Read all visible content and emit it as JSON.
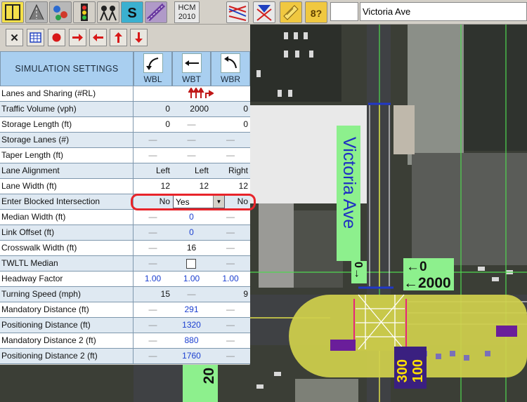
{
  "toolbar": {
    "hcm_line1": "HCM",
    "hcm_line2": "2010",
    "search_value": "",
    "street_name": "Victoria Ave",
    "buttons": [
      "node-settings-icon",
      "lane-settings-icon",
      "volume-settings-icon",
      "timing-settings-icon",
      "phasing-settings-icon",
      "simulation-settings-icon",
      "detector-settings-icon",
      "report-icon",
      "animation-icon",
      "map-info-icon",
      "help-icon"
    ]
  },
  "panel": {
    "tools": [
      "close-icon",
      "table-icon",
      "record-icon",
      "step-right-icon",
      "step-left-icon",
      "up-arrow-icon",
      "down-arrow-icon"
    ],
    "close_glyph": "✕",
    "header": "SIMULATION SETTINGS",
    "movements": [
      "WBL",
      "WBT",
      "WBR"
    ],
    "rows": [
      {
        "label": "Lanes and Sharing (#RL)",
        "values": [
          "",
          "",
          ""
        ]
      },
      {
        "label": "Traffic Volume (vph)",
        "values": [
          "0",
          "2000",
          "0"
        ]
      },
      {
        "label": "Storage Length (ft)",
        "values": [
          "0",
          "—",
          "0"
        ]
      },
      {
        "label": "Storage Lanes (#)",
        "values": [
          "—",
          "—",
          "—"
        ]
      },
      {
        "label": "Taper Length (ft)",
        "values": [
          "—",
          "—",
          "—"
        ]
      },
      {
        "label": "Lane Alignment",
        "values": [
          "Left",
          "Left",
          "Right"
        ]
      },
      {
        "label": "Lane Width (ft)",
        "values": [
          "12",
          "12",
          "12"
        ]
      },
      {
        "label": "Enter Blocked Intersection",
        "values": [
          "No",
          "Yes",
          "No"
        ]
      },
      {
        "label": "Median Width (ft)",
        "values": [
          "—",
          "0",
          "—"
        ]
      },
      {
        "label": "Link Offset (ft)",
        "values": [
          "—",
          "0",
          "—"
        ]
      },
      {
        "label": "Crosswalk Width (ft)",
        "values": [
          "—",
          "16",
          "—"
        ]
      },
      {
        "label": "TWLTL Median",
        "values": [
          "—",
          "",
          "—"
        ]
      },
      {
        "label": "Headway Factor",
        "values": [
          "1.00",
          "1.00",
          "1.00"
        ]
      },
      {
        "label": "Turning Speed (mph)",
        "values": [
          "15",
          "—",
          "9"
        ]
      },
      {
        "label": "Mandatory Distance (ft)",
        "values": [
          "—",
          "291",
          "—"
        ]
      },
      {
        "label": "Positioning Distance (ft)",
        "values": [
          "—",
          "1320",
          "—"
        ]
      },
      {
        "label": "Mandatory Distance 2 (ft)",
        "values": [
          "—",
          "880",
          "—"
        ]
      },
      {
        "label": "Positioning Distance 2 (ft)",
        "values": [
          "—",
          "1760",
          "—"
        ]
      }
    ],
    "dropdown_arrow": "▼"
  },
  "map": {
    "street_label": "Victoria Ave",
    "vol_right_small": "←0",
    "vol_right_big": "←2000",
    "vol_left": "0→",
    "vol_bottom_1": "300",
    "vol_bottom_2": "100",
    "vol_bottom_left": "20"
  },
  "colors": {
    "panel_header": "#a9cff0",
    "row_alt": "#dfe9f2",
    "blue_value": "#1b3fd0",
    "highlight": "#e8242a",
    "road_yellow": "#d8d84a",
    "label_green": "#8df08d"
  }
}
